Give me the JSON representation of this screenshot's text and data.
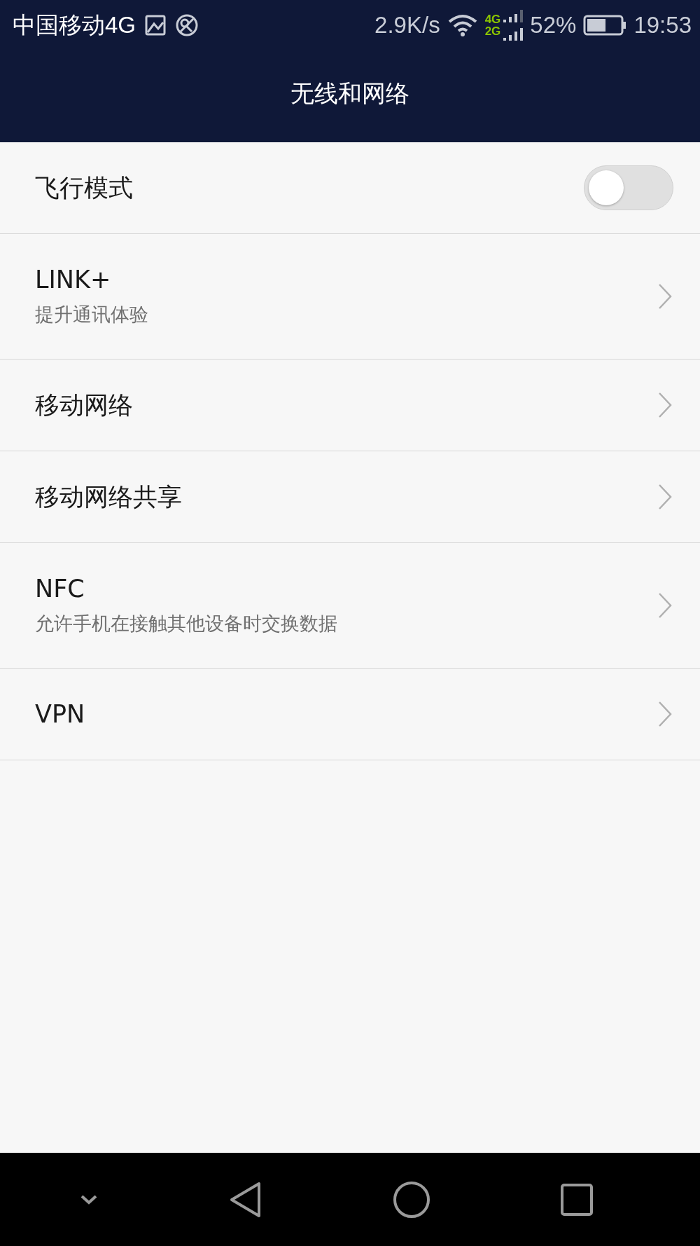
{
  "status_bar": {
    "carrier": "中国移动4G",
    "speed": "2.9K/s",
    "network_labels": [
      "4G",
      "2G"
    ],
    "battery_percent": "52%",
    "time": "19:53"
  },
  "header": {
    "title": "无线和网络"
  },
  "items": [
    {
      "kind": "toggle",
      "label": "飞行模式",
      "on": false
    },
    {
      "kind": "link",
      "label": "LINK+",
      "subtitle": "提升通讯体验"
    },
    {
      "kind": "link",
      "label": "移动网络"
    },
    {
      "kind": "link",
      "label": "移动网络共享"
    },
    {
      "kind": "link",
      "label": "NFC",
      "subtitle": "允许手机在接触其他设备时交换数据"
    },
    {
      "kind": "link",
      "label": "VPN"
    }
  ]
}
